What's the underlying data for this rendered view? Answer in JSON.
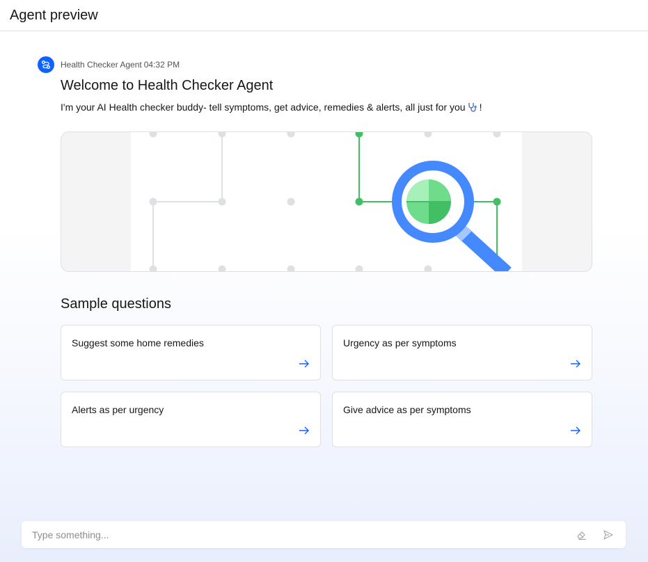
{
  "header": {
    "title": "Agent preview"
  },
  "message": {
    "agent_name": "Health Checker Agent",
    "time": "04:32 PM",
    "welcome_title": "Welcome to Health Checker Agent",
    "welcome_text": "I'm your AI Health checker buddy- tell symptoms, get advice, remedies & alerts, all just for you",
    "welcome_suffix": "!",
    "emoji_icon": "stethoscope-icon"
  },
  "samples": {
    "title": "Sample questions",
    "items": [
      {
        "label": "Suggest some home remedies"
      },
      {
        "label": "Urgency as per symptoms"
      },
      {
        "label": "Alerts as per urgency"
      },
      {
        "label": "Give advice as per symptoms"
      }
    ]
  },
  "composer": {
    "placeholder": "Type something..."
  },
  "colors": {
    "accent": "#0f62fe",
    "green": "#42be65",
    "magnifier": "#4589ff",
    "grid_dot": "#dde1e6"
  }
}
